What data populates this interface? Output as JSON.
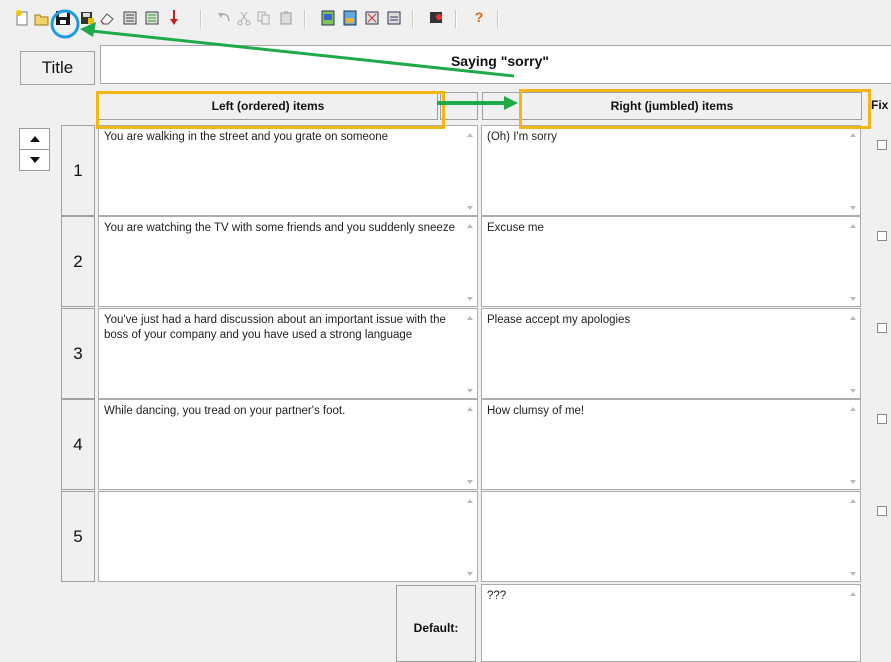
{
  "toolbar": {
    "icons": [
      "new-icon",
      "open-icon",
      "save-icon",
      "save-as-icon",
      "erase-icon",
      "export-icon",
      "export-web-icon",
      "down-arrow-icon",
      "undo-icon",
      "cut-icon",
      "copy-icon",
      "paste-icon",
      "web-icon",
      "config-icon",
      "tools-icon",
      "options-icon",
      "quit-icon",
      "help-icon"
    ],
    "help_label": "?"
  },
  "title": {
    "label": "Title",
    "value": "Saying \"sorry\""
  },
  "headers": {
    "left": "Left (ordered) items",
    "right": "Right (jumbled) items",
    "fix": "Fix"
  },
  "rows": [
    {
      "num": "1",
      "left": "You are walking in the street and you grate on someone",
      "right": "(Oh) I'm sorry"
    },
    {
      "num": "2",
      "left": "You are watching the TV with some friends and you suddenly sneeze",
      "right": "Excuse me"
    },
    {
      "num": "3",
      "left": "You've just had a hard discussion about an important issue with the boss of your company and you have used a strong language",
      "right": "Please accept my apologies"
    },
    {
      "num": "4",
      "left": "While dancing, you tread on your partner's foot.",
      "right": "How clumsy of me!"
    },
    {
      "num": "5",
      "left": "",
      "right": ""
    }
  ],
  "default": {
    "label": "Default:",
    "value": "???"
  },
  "annotations": {
    "highlight_color": "#f5b516",
    "arrow_color": "#1faa4a",
    "circle_color": "#1e9be6"
  }
}
